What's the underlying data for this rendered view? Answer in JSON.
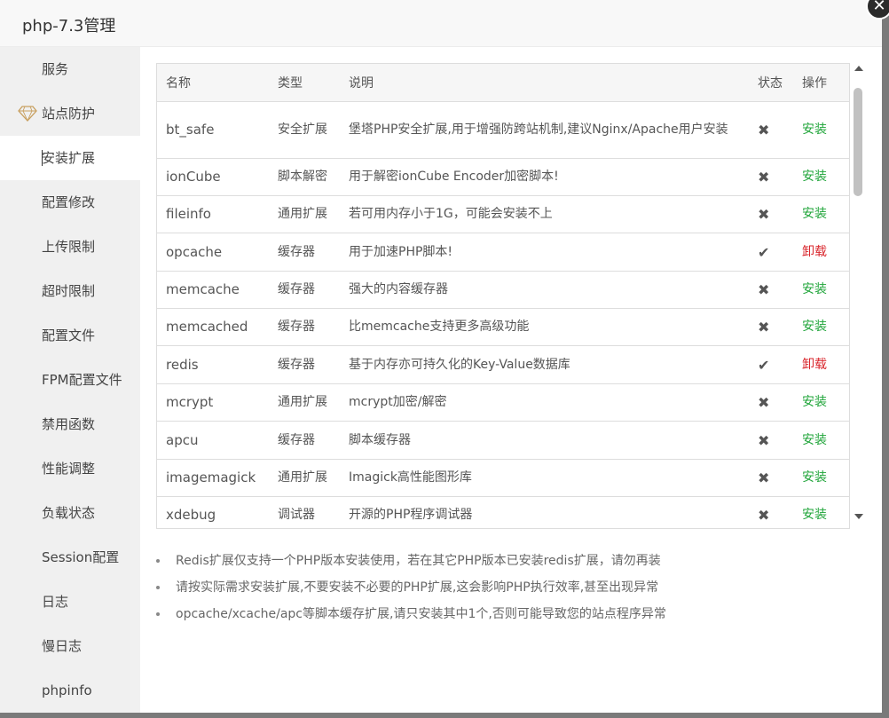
{
  "dialog": {
    "title": "php-7.3管理",
    "close_glyph": "✕"
  },
  "sidebar": {
    "items": [
      {
        "label": "服务"
      },
      {
        "label": "站点防护",
        "icon": "diamond-icon"
      },
      {
        "label": "安装扩展",
        "active": true
      },
      {
        "label": "配置修改"
      },
      {
        "label": "上传限制"
      },
      {
        "label": "超时限制"
      },
      {
        "label": "配置文件"
      },
      {
        "label": "FPM配置文件"
      },
      {
        "label": "禁用函数"
      },
      {
        "label": "性能调整"
      },
      {
        "label": "负载状态"
      },
      {
        "label": "Session配置"
      },
      {
        "label": "日志"
      },
      {
        "label": "慢日志"
      },
      {
        "label": "phpinfo"
      }
    ]
  },
  "table": {
    "headers": {
      "name": "名称",
      "type": "类型",
      "desc": "说明",
      "status": "状态",
      "action": "操作"
    },
    "rows": [
      {
        "name": "bt_safe",
        "type": "安全扩展",
        "desc": "堡塔PHP安全扩展,用于增强防跨站机制,建议Nginx/Apache用户安装",
        "status": "✖",
        "action": "安装"
      },
      {
        "name": "ionCube",
        "type": "脚本解密",
        "desc": "用于解密ionCube Encoder加密脚本!",
        "status": "✖",
        "action": "安装"
      },
      {
        "name": "fileinfo",
        "type": "通用扩展",
        "desc": "若可用内存小于1G，可能会安装不上",
        "status": "✖",
        "action": "安装"
      },
      {
        "name": "opcache",
        "type": "缓存器",
        "desc": "用于加速PHP脚本!",
        "status": "✔",
        "action": "卸载"
      },
      {
        "name": "memcache",
        "type": "缓存器",
        "desc": "强大的内容缓存器",
        "status": "✖",
        "action": "安装"
      },
      {
        "name": "memcached",
        "type": "缓存器",
        "desc": "比memcache支持更多高级功能",
        "status": "✖",
        "action": "安装"
      },
      {
        "name": "redis",
        "type": "缓存器",
        "desc": "基于内存亦可持久化的Key-Value数据库",
        "status": "✔",
        "action": "卸载"
      },
      {
        "name": "mcrypt",
        "type": "通用扩展",
        "desc": "mcrypt加密/解密",
        "status": "✖",
        "action": "安装"
      },
      {
        "name": "apcu",
        "type": "缓存器",
        "desc": "脚本缓存器",
        "status": "✖",
        "action": "安装"
      },
      {
        "name": "imagemagick",
        "type": "通用扩展",
        "desc": "Imagick高性能图形库",
        "status": "✖",
        "action": "安装"
      },
      {
        "name": "xdebug",
        "type": "调试器",
        "desc": "开源的PHP程序调试器",
        "status": "✖",
        "action": "安装"
      }
    ]
  },
  "notes": [
    "Redis扩展仅支持一个PHP版本安装使用，若在其它PHP版本已安装redis扩展，请勿再装",
    "请按实际需求安装扩展,不要安装不必要的PHP扩展,这会影响PHP执行效率,甚至出现异常",
    "opcache/xcache/apc等脚本缓存扩展,请只安装其中1个,否则可能导致您的站点程序异常"
  ],
  "colors": {
    "install": "#20a53a",
    "uninstall": "#d9262c",
    "sidebar_bg": "#f0f0f0"
  }
}
